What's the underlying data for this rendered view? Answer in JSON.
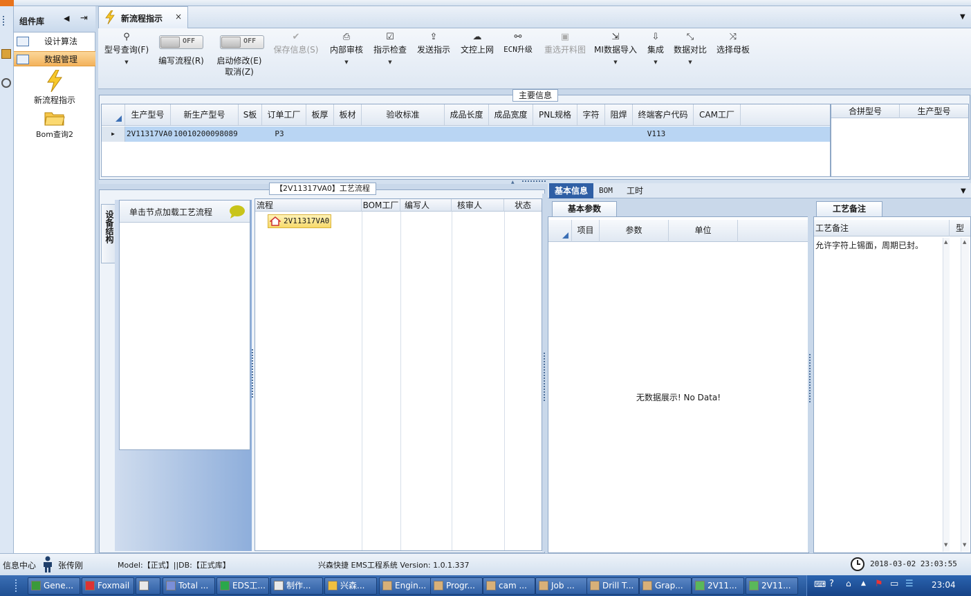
{
  "library": {
    "title": "组件库",
    "nav_items": [
      {
        "label": "设计算法",
        "selected": false
      },
      {
        "label": "数据管理",
        "selected": true
      }
    ],
    "tools": [
      {
        "label": "新流程指示",
        "icon": "lightning-icon"
      },
      {
        "label": "Bom查询2",
        "icon": "folder-icon"
      }
    ]
  },
  "doc_tab": {
    "label": "新流程指示",
    "close": "×"
  },
  "toolbar": {
    "model_query": "型号查询(F)",
    "write_flow": "编写流程(R)",
    "enable_modify": "启动修改(E)",
    "cancel": "取消(Z)",
    "toggle_off": "OFF",
    "save_info": "保存信息(S)",
    "internal_review": "内部审核",
    "instruction_check": "指示检查",
    "send_instruction": "发送指示",
    "doc_upload": "文控上网",
    "ecn_upgrade": "ECN升级",
    "reselect_material_drawing": "重选开料图",
    "mi_data_import": "MI数据导入",
    "integrate": "集成",
    "data_compare": "数据对比",
    "select_mother_board": "选择母板"
  },
  "main_info": {
    "title": "主要信息",
    "columns": [
      "生产型号",
      "新生产型号",
      "S板",
      "订单工厂",
      "板厚",
      "板材",
      "验收标准",
      "成品长度",
      "成品宽度",
      "PNL规格",
      "字符",
      "阻焊",
      "终端客户代码",
      "CAM工厂"
    ],
    "row": [
      "2V11317VA0",
      "10010200098089",
      "",
      "P3",
      "",
      "",
      "",
      "",
      "",
      "",
      "",
      "",
      "V113",
      ""
    ],
    "side_columns": [
      "合拼型号",
      "生产型号"
    ]
  },
  "flow": {
    "title": "【2V11317VA0】工艺流程",
    "vtab_label": "设备结构",
    "hint": "单击节点加载工艺流程",
    "columns": [
      "流程",
      "BOM工厂",
      "编写人",
      "核审人",
      "状态"
    ],
    "root_node": "2V11317VA0"
  },
  "detail": {
    "tabs": [
      "基本信息",
      "BOM",
      "工时"
    ],
    "params_tab": "基本参数",
    "columns": [
      "项目",
      "参数",
      "单位"
    ],
    "empty": "无数据展示! No Data!"
  },
  "remarks": {
    "tab": "工艺备注",
    "col1": "工艺备注",
    "col2": "型",
    "text": "允许字符上锡面，周期已封。"
  },
  "statusbar": {
    "info_center": "信息中心",
    "user": "张传刚",
    "model_db": "Model:【正式】||DB:【正式库】",
    "version": "兴森快捷 EMS工程系统 Version: 1.0.1.337",
    "datetime": "2018-03-02 23:03:55"
  },
  "taskbar": {
    "items": [
      "Gene...",
      "Foxmail",
      "",
      "Total ...",
      "EDS工...",
      "制作...",
      "兴森...",
      "Engin...",
      "Progr...",
      "cam ...",
      "Job ...",
      "Drill T...",
      "Grap...",
      "2V11...",
      "2V11..."
    ],
    "clock": "23:04"
  },
  "colors": {
    "accent": "#f3b25b",
    "selection": "#b9d5f3",
    "taskbar": "#2a5aa0"
  }
}
